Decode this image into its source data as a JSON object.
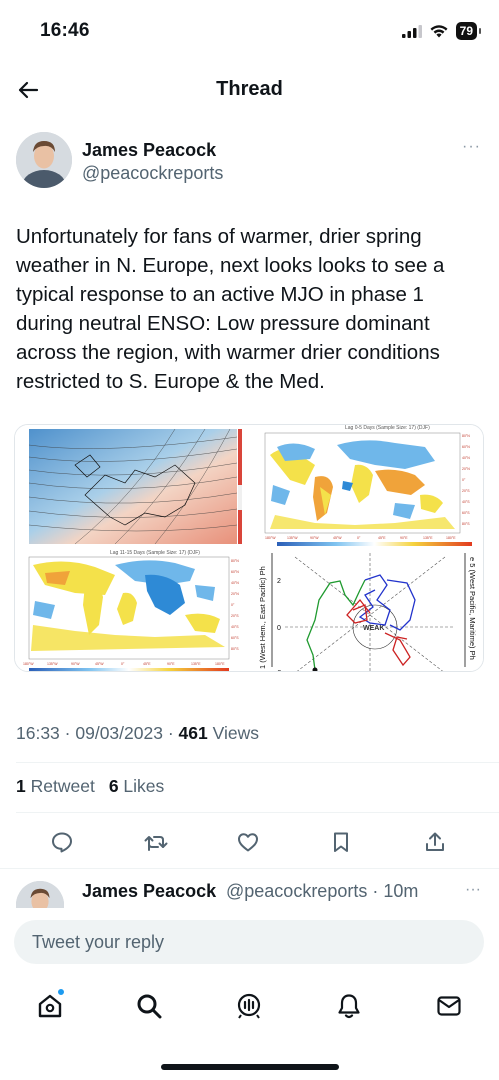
{
  "status_bar": {
    "time": "16:46",
    "battery": "79"
  },
  "header": {
    "title": "Thread"
  },
  "tweet": {
    "author_name": "James Peacock",
    "author_handle": "@peacockreports",
    "more": "···",
    "text": "Unfortunately for fans of warmer, drier spring weather in N. Europe, next looks looks to see a typical response to an active MJO in phase 1 during neutral ENSO: Low pressure dominant across the region, with warmer drier conditions restricted to S. Europe & the Med.",
    "time": "16:33",
    "date": "09/03/2023",
    "views_count": "461",
    "views_label": "Views",
    "retweets_count": "1",
    "retweets_label": "Retweet",
    "likes_count": "6",
    "likes_label": "Likes"
  },
  "media": {
    "map_tr_title": "Lag 0-5 Days (Sample Size: 17) (DJF)",
    "map_bl_title": "Lag 11-15 Days (Sample Size: 17) (DJF)",
    "lon_labels": [
      "180°W",
      "135°W",
      "90°W",
      "45°W",
      "0°",
      "45°E",
      "90°E",
      "135°E",
      "180°E"
    ],
    "lat_labels": [
      "80°N",
      "60°N",
      "40°N",
      "20°N",
      "0°",
      "20°S",
      "40°S",
      "60°S",
      "80°S"
    ],
    "mjo_left_axis": "1 (West Hem., East Pacific) Ph",
    "mjo_right_axis": "e 5 (West Pacific, Maritime) Ph",
    "mjo_ticks": [
      "2",
      "0",
      "-2"
    ],
    "mjo_center": "WEAK",
    "colors": {
      "warm": "#f0a33a",
      "yellow": "#f4e14a",
      "cool": "#6fb7ea",
      "deep_cool": "#2e8ad6",
      "ocean": "#ffffff"
    }
  },
  "reply_preview": {
    "author_name": "James Peacock",
    "author_handle": "@peacockreports",
    "time": "10m"
  },
  "reply_input": {
    "placeholder": "Tweet your reply"
  },
  "nav": {
    "items": [
      "home-icon",
      "search-icon",
      "spaces-icon",
      "notifications-icon",
      "messages-icon"
    ]
  }
}
